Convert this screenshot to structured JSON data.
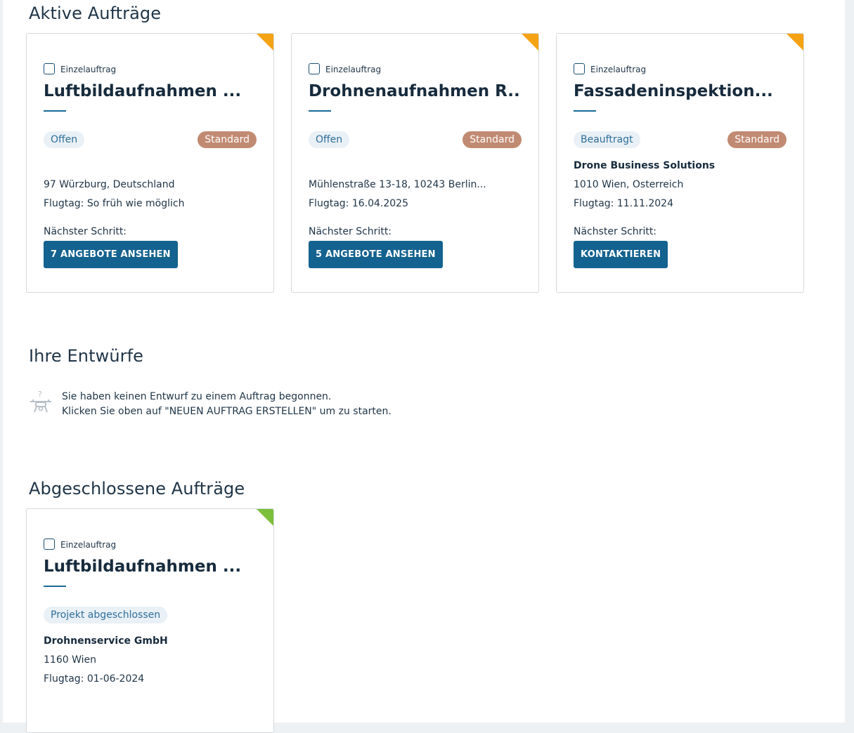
{
  "active": {
    "heading": "Aktive Aufträge",
    "cards": [
      {
        "type": "Einzelauftrag",
        "title": "Luftbildaufnahmen ...",
        "status": "Offen",
        "tier": "Standard",
        "address": "97 Würzburg, Deutschland",
        "flight_day": "Flugtag: So früh wie möglich",
        "next_label": "Nächster Schritt:",
        "action": "7 ANGEBOTE ANSEHEN",
        "corner_color": "#f5a314"
      },
      {
        "type": "Einzelauftrag",
        "title": "Drohnenaufnahmen R...",
        "status": "Offen",
        "tier": "Standard",
        "address": "Mühlenstraße 13-18, 10243 Berlin...",
        "flight_day": "Flugtag: 16.04.2025",
        "next_label": "Nächster Schritt:",
        "action": "5 ANGEBOTE ANSEHEN",
        "corner_color": "#f5a314"
      },
      {
        "type": "Einzelauftrag",
        "title": "Fassadeninspektion...",
        "status": "Beauftragt",
        "tier": "Standard",
        "provider": "Drone Business Solutions",
        "address": "1010 Wien, Österreich",
        "flight_day": "Flugtag: 11.11.2024",
        "next_label": "Nächster Schritt:",
        "action": "KONTAKTIEREN",
        "corner_color": "#f5a314"
      }
    ]
  },
  "drafts": {
    "heading": "Ihre Entwürfe",
    "empty_line1": "Sie haben keinen Entwurf zu einem Auftrag begonnen.",
    "empty_line2": "Klicken Sie oben auf \"NEUEN AUFTRAG ERSTELLEN\" um zu starten.",
    "empty_icon": "drone-question-icon"
  },
  "completed": {
    "heading": "Abgeschlossene Aufträge",
    "cards": [
      {
        "type": "Einzelauftrag",
        "title": "Luftbildaufnahmen ...",
        "status": "Projekt abgeschlossen",
        "provider": "Drohnenservice GmbH",
        "address": "1160 Wien",
        "flight_day": "Flugtag: 01-06-2024",
        "corner_color": "#7cbf3a"
      }
    ]
  },
  "colors": {
    "primary_button": "#14628f",
    "tier_chip": "#c18a72",
    "status_chip_bg": "#e9f0f6",
    "status_chip_text": "#2e6f9a",
    "active_corner": "#f5a314",
    "completed_corner": "#7cbf3a"
  }
}
